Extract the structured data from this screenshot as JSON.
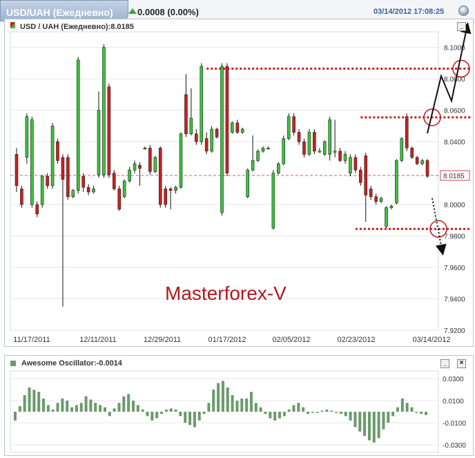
{
  "header": {
    "tab_title": "USD/UAH (Ежедневно)",
    "change": "0.0008 (0.00%)",
    "timestamp": "03/14/2012 17:08:25"
  },
  "main_panel": {
    "legend": "USD / UAH (Ежедневно):8.0185",
    "minimize_label": "_",
    "watermark": "Masterforex-V"
  },
  "osc_panel": {
    "legend": "Awesome Oscillator:-0.0014",
    "minimize_label": "_",
    "close_label": "×"
  },
  "colors": {
    "up_candle": "#3cc23c",
    "down_candle": "#cc1f1f",
    "level_line": "#c81e1e",
    "oscillator": "#6b9a6b",
    "current_price": "#e05a5a"
  },
  "chart_data": [
    {
      "type": "candlestick",
      "title": "USD / UAH (Ежедневно):8.0185",
      "current_price": 8.0185,
      "current_price_label": "8.0185",
      "ylim": [
        7.92,
        8.11
      ],
      "y_ticks": [
        {
          "value": 8.1,
          "label": "8.1000"
        },
        {
          "value": 8.08,
          "label": "8.0800"
        },
        {
          "value": 8.06,
          "label": "8.0600"
        },
        {
          "value": 8.04,
          "label": "8.0400"
        },
        {
          "value": 8.0,
          "label": "8.0000"
        },
        {
          "value": 7.98,
          "label": "7.9800"
        },
        {
          "value": 7.96,
          "label": "7.9600"
        },
        {
          "value": 7.94,
          "label": "7.9400"
        },
        {
          "value": 7.92,
          "label": "7.9200"
        }
      ],
      "x_ticks": [
        {
          "index": 0,
          "label": "11/17/2011"
        },
        {
          "index": 12,
          "label": "12/11/2011"
        },
        {
          "index": 24,
          "label": "12/29/2011"
        },
        {
          "index": 38,
          "label": "01/17/2012"
        },
        {
          "index": 50,
          "label": "02/05/2012"
        },
        {
          "index": 64,
          "label": "02/23/2012"
        },
        {
          "index": 79,
          "label": "03/14/2012"
        }
      ],
      "levels": [
        {
          "price": 8.0865,
          "from_index": 37
        },
        {
          "price": 8.0555,
          "from_index": 67
        },
        {
          "price": 7.9845,
          "from_index": 66
        }
      ],
      "candles": [
        [
          8.032,
          8.012,
          8.036,
          8.008
        ],
        [
          8.01,
          8.0,
          8.012,
          7.998
        ],
        [
          8.03,
          8.056,
          8.058,
          8.026
        ],
        [
          8.0,
          8.054,
          8.056,
          7.998
        ],
        [
          8.0,
          7.994,
          8.002,
          7.992
        ],
        [
          8.0,
          8.018,
          8.019,
          7.998
        ],
        [
          8.018,
          8.012,
          8.02,
          8.01
        ],
        [
          8.012,
          8.05,
          8.052,
          8.01
        ],
        [
          8.04,
          8.028,
          8.042,
          8.026
        ],
        [
          8.03,
          8.016,
          8.032,
          7.935
        ],
        [
          8.03,
          8.005,
          8.032,
          8.003
        ],
        [
          8.005,
          8.009,
          8.01,
          8.004
        ],
        [
          8.009,
          8.092,
          8.094,
          8.007
        ],
        [
          8.018,
          8.011,
          8.02,
          8.008
        ],
        [
          8.011,
          8.008,
          8.013,
          8.006
        ],
        [
          8.008,
          8.01,
          8.012,
          8.007
        ],
        [
          8.019,
          8.06,
          8.072,
          8.017
        ],
        [
          8.019,
          8.1,
          8.102,
          8.017
        ],
        [
          8.075,
          8.019,
          8.077,
          8.017
        ],
        [
          8.02,
          8.01,
          8.022,
          8.009
        ],
        [
          8.01,
          7.997,
          8.012,
          7.996
        ],
        [
          8.005,
          8.015,
          8.016,
          8.004
        ],
        [
          8.015,
          8.022,
          8.024,
          8.014
        ],
        [
          8.022,
          8.026,
          8.028,
          8.02
        ],
        [
          8.025,
          8.023,
          8.027,
          8.012
        ],
        [
          8.036,
          8.036,
          8.037,
          8.035
        ],
        [
          8.036,
          8.021,
          8.038,
          8.019
        ],
        [
          8.021,
          8.03,
          8.031,
          8.02
        ],
        [
          8.036,
          8.0,
          8.037,
          7.998
        ],
        [
          8.01,
          8.0,
          8.012,
          7.998
        ],
        [
          8.01,
          8.009,
          8.011,
          7.997
        ],
        [
          8.009,
          8.011,
          8.012,
          8.007
        ],
        [
          8.011,
          8.045,
          8.046,
          8.01
        ],
        [
          8.07,
          8.045,
          8.083,
          8.043
        ],
        [
          8.045,
          8.055,
          8.074,
          8.044
        ],
        [
          8.045,
          8.04,
          8.048,
          8.038
        ],
        [
          8.04,
          8.088,
          8.09,
          8.038
        ],
        [
          8.042,
          8.034,
          8.046,
          8.032
        ],
        [
          8.034,
          8.048,
          8.05,
          8.033
        ],
        [
          8.048,
          8.043,
          8.049,
          8.042
        ],
        [
          7.995,
          8.088,
          8.09,
          7.993
        ],
        [
          8.088,
          8.02,
          8.09,
          8.018
        ],
        [
          8.046,
          8.052,
          8.053,
          8.045
        ],
        [
          8.052,
          8.046,
          8.054,
          8.045
        ],
        [
          8.046,
          8.048,
          8.049,
          8.045
        ],
        [
          8.005,
          8.022,
          8.023,
          8.004
        ],
        [
          8.022,
          8.028,
          8.044,
          8.021
        ],
        [
          8.028,
          8.034,
          8.035,
          8.027
        ],
        [
          8.034,
          8.036,
          8.037,
          8.033
        ],
        [
          8.036,
          8.036,
          8.037,
          8.035
        ],
        [
          7.985,
          8.02,
          8.022,
          7.984
        ],
        [
          8.02,
          8.026,
          8.027,
          8.019
        ],
        [
          8.026,
          8.042,
          8.044,
          8.025
        ],
        [
          8.042,
          8.056,
          8.058,
          8.041
        ],
        [
          8.056,
          8.046,
          8.058,
          8.044
        ],
        [
          8.046,
          8.04,
          8.048,
          8.038
        ],
        [
          8.04,
          8.032,
          8.042,
          8.03
        ],
        [
          8.032,
          8.046,
          8.048,
          8.031
        ],
        [
          8.046,
          8.034,
          8.048,
          8.032
        ],
        [
          8.034,
          8.034,
          8.036,
          8.033
        ],
        [
          8.032,
          8.04,
          8.041,
          8.031
        ],
        [
          8.032,
          8.054,
          8.056,
          8.028
        ],
        [
          8.034,
          8.034,
          8.054,
          8.03
        ],
        [
          8.034,
          8.028,
          8.036,
          8.027
        ],
        [
          8.028,
          8.032,
          8.034,
          8.026
        ],
        [
          8.02,
          8.03,
          8.032,
          8.018
        ],
        [
          8.03,
          8.022,
          8.032,
          8.02
        ],
        [
          8.022,
          8.014,
          8.024,
          8.012
        ],
        [
          8.031,
          8.006,
          8.033,
          7.989
        ],
        [
          8.01,
          8.005,
          8.012,
          8.003
        ],
        [
          8.005,
          8.002,
          8.007,
          8.0
        ],
        [
          8.002,
          8.004,
          8.005,
          8.001
        ],
        [
          7.986,
          7.998,
          7.999,
          7.985
        ],
        [
          7.998,
          7.999,
          8.0,
          7.997
        ],
        [
          8.001,
          8.028,
          8.029,
          8.0
        ],
        [
          8.028,
          8.042,
          8.043,
          8.027
        ],
        [
          8.056,
          8.036,
          8.058,
          8.034
        ],
        [
          8.036,
          8.03,
          8.037,
          8.029
        ],
        [
          8.03,
          8.026,
          8.031,
          8.025
        ],
        [
          8.026,
          8.028,
          8.029,
          8.025
        ],
        [
          8.028,
          8.018,
          8.029,
          8.017
        ]
      ]
    },
    {
      "type": "bar",
      "title": "Awesome Oscillator:-0.0014",
      "ylim": [
        -0.037,
        0.037
      ],
      "y_ticks": [
        {
          "value": 0.03,
          "label": "0.0300"
        },
        {
          "value": 0.01,
          "label": "0.0100"
        },
        {
          "value": -0.01,
          "label": "-0.0100"
        },
        {
          "value": -0.03,
          "label": "-0.0300"
        }
      ],
      "values": [
        -0.008,
        0.005,
        0.015,
        0.022,
        0.02,
        0.018,
        0.012,
        0.006,
        0.002,
        0.008,
        0.012,
        0.01,
        0.004,
        0.006,
        0.008,
        0.014,
        0.011,
        0.008,
        0.006,
        0.004,
        -0.004,
        0.003,
        0.008,
        0.014,
        0.016,
        0.01,
        0.006,
        0.002,
        -0.004,
        -0.008,
        -0.006,
        -0.002,
        0.002,
        0.003,
        0.002,
        -0.004,
        -0.01,
        -0.012,
        -0.014,
        -0.008,
        -0.002,
        0.008,
        0.02,
        0.026,
        0.028,
        0.022,
        0.015,
        0.01,
        0.012,
        0.012,
        0.018,
        0.008,
        0.004,
        -0.002,
        -0.006,
        -0.008,
        -0.006,
        -0.004,
        0.002,
        0.006,
        0.008,
        0.004,
        -0.002,
        -0.001,
        -0.001,
        0.001,
        0.002,
        0.001,
        -0.001,
        -0.002,
        -0.004,
        -0.008,
        -0.014,
        -0.018,
        -0.022,
        -0.026,
        -0.028,
        -0.024,
        -0.016,
        -0.01,
        -0.004,
        0.004,
        0.012,
        0.008,
        0.004,
        -0.001,
        -0.002,
        -0.003
      ]
    }
  ]
}
